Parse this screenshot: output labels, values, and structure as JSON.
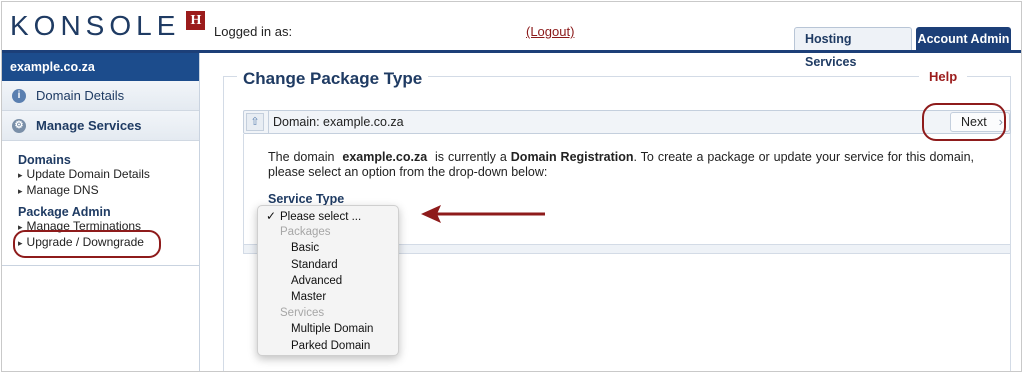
{
  "brand": {
    "logo_text": "KONSOLE",
    "logo_badge": "H",
    "accent_color": "#1c3f78",
    "badge_color": "#9b1c1c"
  },
  "header": {
    "logged_in_label": "Logged in as:",
    "logout_label": "(Logout)",
    "tabs": [
      {
        "label": "Hosting Services",
        "active": false
      },
      {
        "label": "Account Admin",
        "active": true
      }
    ]
  },
  "sidebar": {
    "title": "example.co.za",
    "items": [
      {
        "label": "Domain Details",
        "icon": "info-icon"
      },
      {
        "label": "Manage Services",
        "icon": "gear-icon"
      }
    ],
    "menu": {
      "domains_heading": "Domains",
      "domains_links": [
        "Update Domain Details",
        "Manage DNS"
      ],
      "package_heading": "Package Admin",
      "package_links": [
        "Manage Terminations",
        "Upgrade / Downgrade"
      ]
    }
  },
  "main": {
    "title": "Change Package Type",
    "help_label": "Help",
    "domain_bar_label": "Domain: example.co.za",
    "next_label": "Next",
    "description_prefix": "The domain",
    "domain_name": "example.co.za",
    "description_middle": "is currently a",
    "service_kind": "Domain Registration",
    "description_suffix": ". To create a package or update your service for this domain, please select an option from the drop-down below:",
    "service_type_label": "Service Type"
  },
  "dropdown": {
    "selected": "Please select ...",
    "options": [
      {
        "label": "Please select ...",
        "type": "selected"
      },
      {
        "label": "Packages",
        "type": "group"
      },
      {
        "label": "Basic",
        "type": "option"
      },
      {
        "label": "Standard",
        "type": "option"
      },
      {
        "label": "Advanced",
        "type": "option"
      },
      {
        "label": "Master",
        "type": "option"
      },
      {
        "label": "Services",
        "type": "group"
      },
      {
        "label": "Multiple Domain",
        "type": "option"
      },
      {
        "label": "Parked Domain",
        "type": "option"
      }
    ]
  }
}
